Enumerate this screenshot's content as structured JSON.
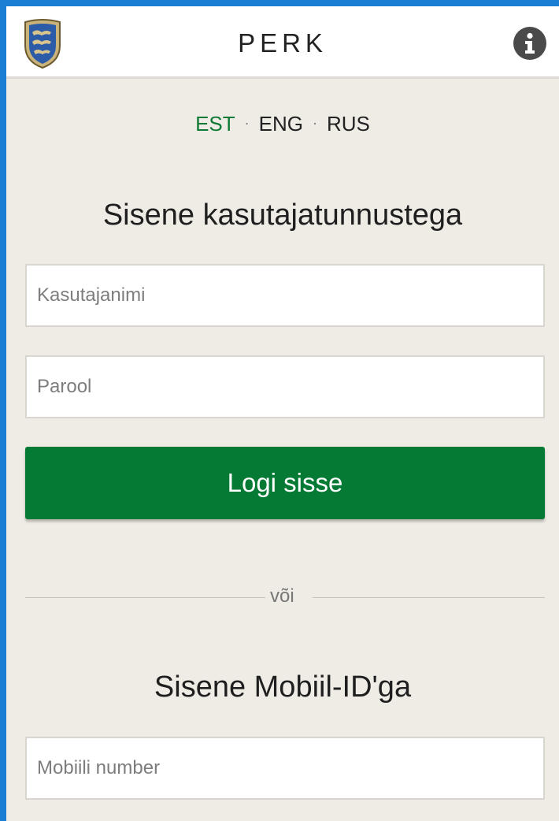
{
  "header": {
    "title": "PERK",
    "logo_icon": "estonian-coat-of-arms",
    "info_icon": "info-circle-icon"
  },
  "languages": [
    {
      "label": "EST",
      "active": true
    },
    {
      "label": "ENG",
      "active": false
    },
    {
      "label": "RUS",
      "active": false
    }
  ],
  "language_separator": "·",
  "login": {
    "heading": "Sisene kasutajatunnustega",
    "username_placeholder": "Kasutajanimi",
    "password_placeholder": "Parool",
    "submit_label": "Logi sisse"
  },
  "divider_text": "või",
  "mobile_id": {
    "heading": "Sisene Mobiil-ID'ga",
    "phone_placeholder": "Mobiili number"
  },
  "colors": {
    "accent": "#057a34",
    "active_language": "#0f7a36",
    "background": "#efebe5",
    "frame": "#1a7fd4"
  }
}
